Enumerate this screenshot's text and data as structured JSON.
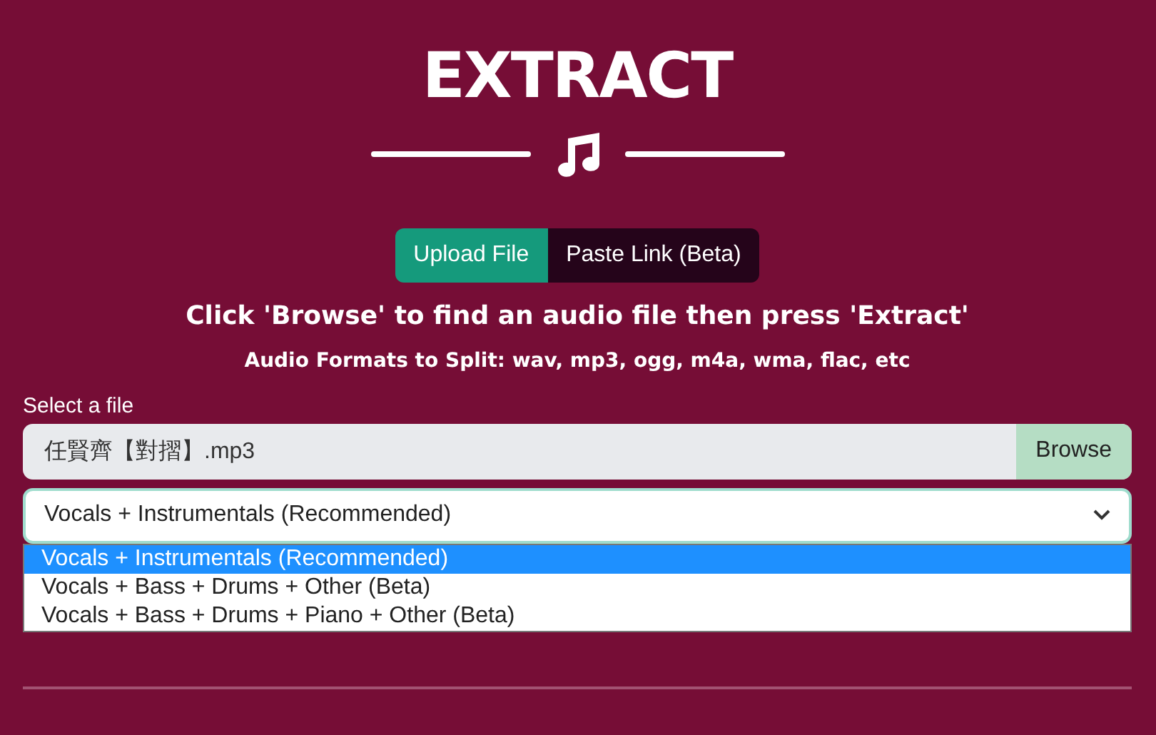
{
  "title": "EXTRACT",
  "mode_tabs": [
    {
      "label": "Upload File",
      "selected": true
    },
    {
      "label": "Paste Link (Beta)",
      "selected": false
    }
  ],
  "instruction": "Click 'Browse' to find an audio file then press 'Extract'",
  "formats_note": "Audio Formats to Split: wav, mp3, ogg, m4a, wma, flac, etc",
  "file_field": {
    "label": "Select a file",
    "value": "任賢齊【對摺】.mp3",
    "button": "Browse"
  },
  "separation_select": {
    "value": "Vocals + Instrumentals (Recommended)",
    "expanded": true,
    "options": [
      {
        "label": "Vocals + Instrumentals (Recommended)",
        "selected": true
      },
      {
        "label": "Vocals + Bass + Drums + Other (Beta)",
        "selected": false
      },
      {
        "label": "Vocals + Bass + Drums + Piano + Other (Beta)",
        "selected": false
      }
    ]
  }
}
